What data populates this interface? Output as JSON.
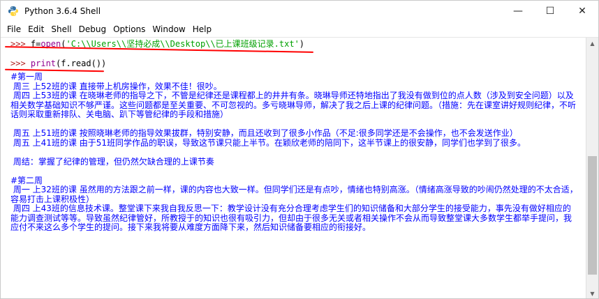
{
  "window": {
    "title": "Python 3.6.4 Shell",
    "controls": {
      "minimize": "—",
      "maximize": "☐",
      "close": "✕"
    }
  },
  "menu": [
    "File",
    "Edit",
    "Shell",
    "Debug",
    "Options",
    "Window",
    "Help"
  ],
  "shell": {
    "prompt": ">>> ",
    "cmd1": {
      "var": "f=",
      "func": "open",
      "paren_open": "(",
      "string": "'C:\\\\Users\\\\坚持必成\\\\Desktop\\\\已上课班级记录.txt'",
      "paren_close": ")"
    },
    "cmd2": {
      "func": "print",
      "rest": "(f.read())"
    },
    "output": "#第一周\n 周三 上52班的课 直接带上机房操作，效果不佳！很吵。\n 周四 上53班的课 在晓琳老师的指导之下，不管是纪律还是课程都上的井井有条。晓琳导师还特地指出了我没有做到位的点人数（涉及到安全问题）以及\n相关数学基础知识不够严谨。这些问题都是至关重要、不可忽视的。多亏晓琳导师，解决了我之后上课的纪律问题。（措施：先在课室讲好规则纪律，不听\n话则采取重新排队、关电脑、趴下等管纪律的手段和措施）\n\n 周五 上51班的课 按照晓琳老师的指导效果拔群，特别安静，而且还收到了很多小作品（不足:很多同学还是不会操作，也不会发送作业）\n 周五 上41班的课 由于51班同学作品的职误，导致这节课只能上半节。在颖欣老师的陪同下，这半节课上的很安静，同学们也学到了很多。\n\n 周结：掌握了纪律的管理，但仍然欠缺合理的上课节奏\n\n#第二周\n 周一 上32班的课 虽然用的方法跟之前一样，课的内容也大致一样。但同学们还是有点吵，情绪也特别高涨。（情绪高涨导致的吵闹仍然处理的不太合适，\n容易打击上课积极性）\n 周四 上43班的信息技术课。整堂课下来我自我反思一下：教学设计没有充分合理考虑学生们的知识储备和大部分学生的接受能力，事先没有做好相应的\n能力调查测试等等。导致虽然纪律管好，所教授于的知识也很有吸引力，但却由于很多无关或者相关操作不会从而导致整堂课大多数学生都举手提问，我\n应付不来这么多个学生的提问。接下来我将要从难度方面降下来，然后知识储备要相应的衔接好。"
  }
}
